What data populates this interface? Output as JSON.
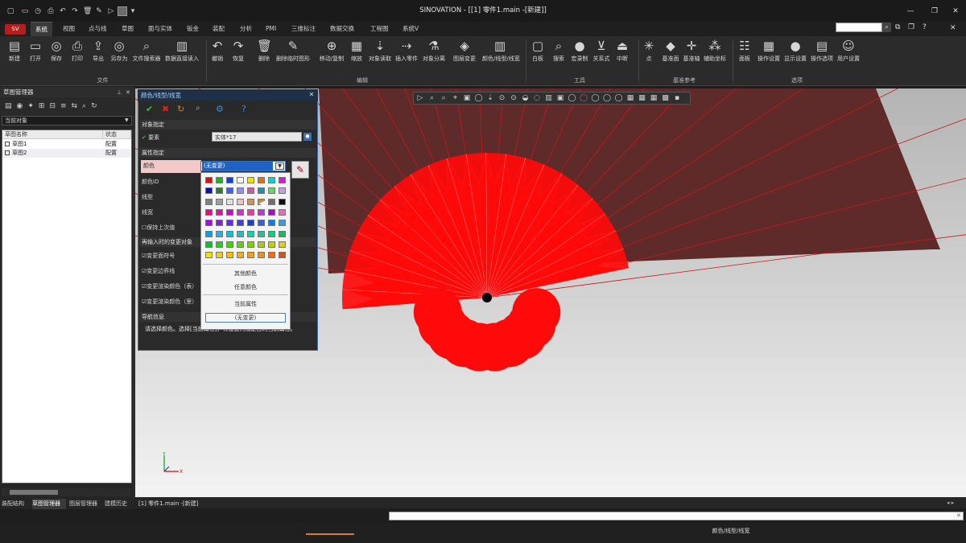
{
  "window": {
    "title": "SINOVATION - [[1] 零件1.main -[新建]]"
  },
  "brand_label": "SV",
  "tabs": [
    {
      "label": "系统",
      "active": true
    },
    {
      "label": "视图"
    },
    {
      "label": "点与线"
    },
    {
      "label": "草图"
    },
    {
      "label": "面与实体"
    },
    {
      "label": "钣金"
    },
    {
      "label": "装配"
    },
    {
      "label": "分析"
    },
    {
      "label": "PMI"
    },
    {
      "label": "三维标注"
    },
    {
      "label": "数据交换"
    },
    {
      "label": "工程图"
    },
    {
      "label": "系统V"
    }
  ],
  "ribbon": {
    "buttons": [
      {
        "label": "新建",
        "icon": "new-doc-icon"
      },
      {
        "label": "打开",
        "icon": "folder-icon"
      },
      {
        "label": "保存",
        "icon": "save-icon"
      },
      {
        "label": "打印",
        "icon": "print-icon"
      },
      {
        "label": "导出",
        "icon": "export-icon"
      },
      {
        "label": "另存为",
        "icon": "save-as-icon"
      },
      {
        "label": "文件搜索器",
        "icon": "file-search-icon"
      },
      {
        "label": "数据直接读入",
        "icon": "data-import-icon"
      },
      {
        "label": "撤销",
        "icon": "undo-icon"
      },
      {
        "label": "恢复",
        "icon": "redo-icon"
      },
      {
        "label": "删除",
        "icon": "trash-icon"
      },
      {
        "label": "删除临时图形",
        "icon": "erase-temp-icon"
      },
      {
        "label": "移动/复制",
        "icon": "move-copy-icon"
      },
      {
        "label": "缩放",
        "icon": "scale-icon"
      },
      {
        "label": "对象读取",
        "icon": "object-read-icon"
      },
      {
        "label": "插入零件",
        "icon": "insert-part-icon"
      },
      {
        "label": "对象分离",
        "icon": "object-split-icon"
      },
      {
        "label": "图层变更",
        "icon": "layer-change-icon"
      },
      {
        "label": "颜色/线型/线宽",
        "icon": "color-line-icon"
      },
      {
        "label": "白板",
        "icon": "whiteboard-icon"
      },
      {
        "label": "搜索",
        "icon": "search-icon"
      },
      {
        "label": "宏录制",
        "icon": "macro-record-icon"
      },
      {
        "label": "关系式",
        "icon": "relation-icon"
      },
      {
        "label": "中断",
        "icon": "interrupt-icon"
      },
      {
        "label": "点",
        "icon": "point-icon"
      },
      {
        "label": "基准面",
        "icon": "datum-plane-icon"
      },
      {
        "label": "基准轴",
        "icon": "datum-axis-icon"
      },
      {
        "label": "辅助坐标",
        "icon": "aux-coord-icon"
      },
      {
        "label": "面板",
        "icon": "panel-icon"
      },
      {
        "label": "操作设置",
        "icon": "op-settings-icon"
      },
      {
        "label": "显示设置",
        "icon": "display-settings-icon"
      },
      {
        "label": "操作选项",
        "icon": "op-options-icon"
      },
      {
        "label": "用户设置",
        "icon": "user-settings-icon"
      }
    ],
    "groups": [
      "文件",
      "编辑",
      "工具",
      "基准参考",
      "选项"
    ]
  },
  "left_panel": {
    "title": "草图管理器",
    "combo": "当前对象",
    "columns": [
      "草图名称",
      "状态"
    ],
    "rows": [
      {
        "name": "草图1",
        "status": "配置"
      },
      {
        "name": "草图2",
        "status": "配置"
      }
    ],
    "bottom_tabs": [
      "装配结构",
      "草图管理器",
      "图层管理器",
      "建模历史"
    ]
  },
  "dialog": {
    "title": "颜色/线型/线宽",
    "sec_object": "对象指定",
    "element_label": "要素",
    "element_value": "实体*17",
    "sec_attr": "属性指定",
    "color_label": "颜色",
    "color_id_label": "颜色ID",
    "linetype_label": "线型",
    "linewidth_label": "线宽",
    "keep_last": "保持上次值",
    "sec_change": "再输入时的变更对象",
    "change_items": [
      "变更面符号",
      "变更边界线",
      "变更渲染颜色（表）",
      "变更渲染颜色（里）"
    ],
    "sec_nav": "导航信息",
    "nav_text": "请选择颜色。选择[当前属性]，将设置为指定目的当前属性。",
    "combo_value": "(无变更)",
    "palette_colors": [
      [
        "#e01010",
        "#10c010",
        "#1040e0",
        "#ffffff",
        "#f0e010",
        "#e07010",
        "#10d0d0",
        "#e010e0"
      ],
      [
        "#1010a0",
        "#208030",
        "#4060e0",
        "#9090f0",
        "#c060a0",
        "#2090b0",
        "#70d070",
        "#c0a0e0"
      ],
      [
        "#808080",
        "#a0a0a0",
        "#e0e0e0",
        "#f0c0c0",
        "#d09060",
        "#c09040",
        "#707070",
        "#101010"
      ],
      [
        "#e01080",
        "#e010a0",
        "#c010c0",
        "#d030d0",
        "#e040a0",
        "#c030e0",
        "#a010c0",
        "#e070c0"
      ],
      [
        "#a010e0",
        "#8020e0",
        "#6030e0",
        "#4040e0",
        "#2040c0",
        "#3060e0",
        "#1080e0",
        "#30a0e0"
      ],
      [
        "#10a0e0",
        "#20b0f0",
        "#10c0d0",
        "#20c0c0",
        "#10d0b0",
        "#20c0a0",
        "#10d080",
        "#10c060"
      ],
      [
        "#10c030",
        "#20d020",
        "#40d010",
        "#60d010",
        "#80d010",
        "#a0d010",
        "#c0d010",
        "#e0d010"
      ],
      [
        "#f0e010",
        "#f0d010",
        "#f0c010",
        "#f0b010",
        "#f0a010",
        "#f09010",
        "#f07010",
        "#e05010"
      ]
    ],
    "other_color": "其他颜色",
    "any_color": "任意颜色",
    "current_attr": "当前属性",
    "no_change": "(无变更)"
  },
  "doc_tab": "[1] 零件1.main -[新建]",
  "status_text": "颜色/线型/线宽",
  "progress": 0,
  "colors": {
    "accent": "#3b6fb0",
    "fan": "#ff0a0a",
    "fan_dark": "#5e2a2a"
  }
}
